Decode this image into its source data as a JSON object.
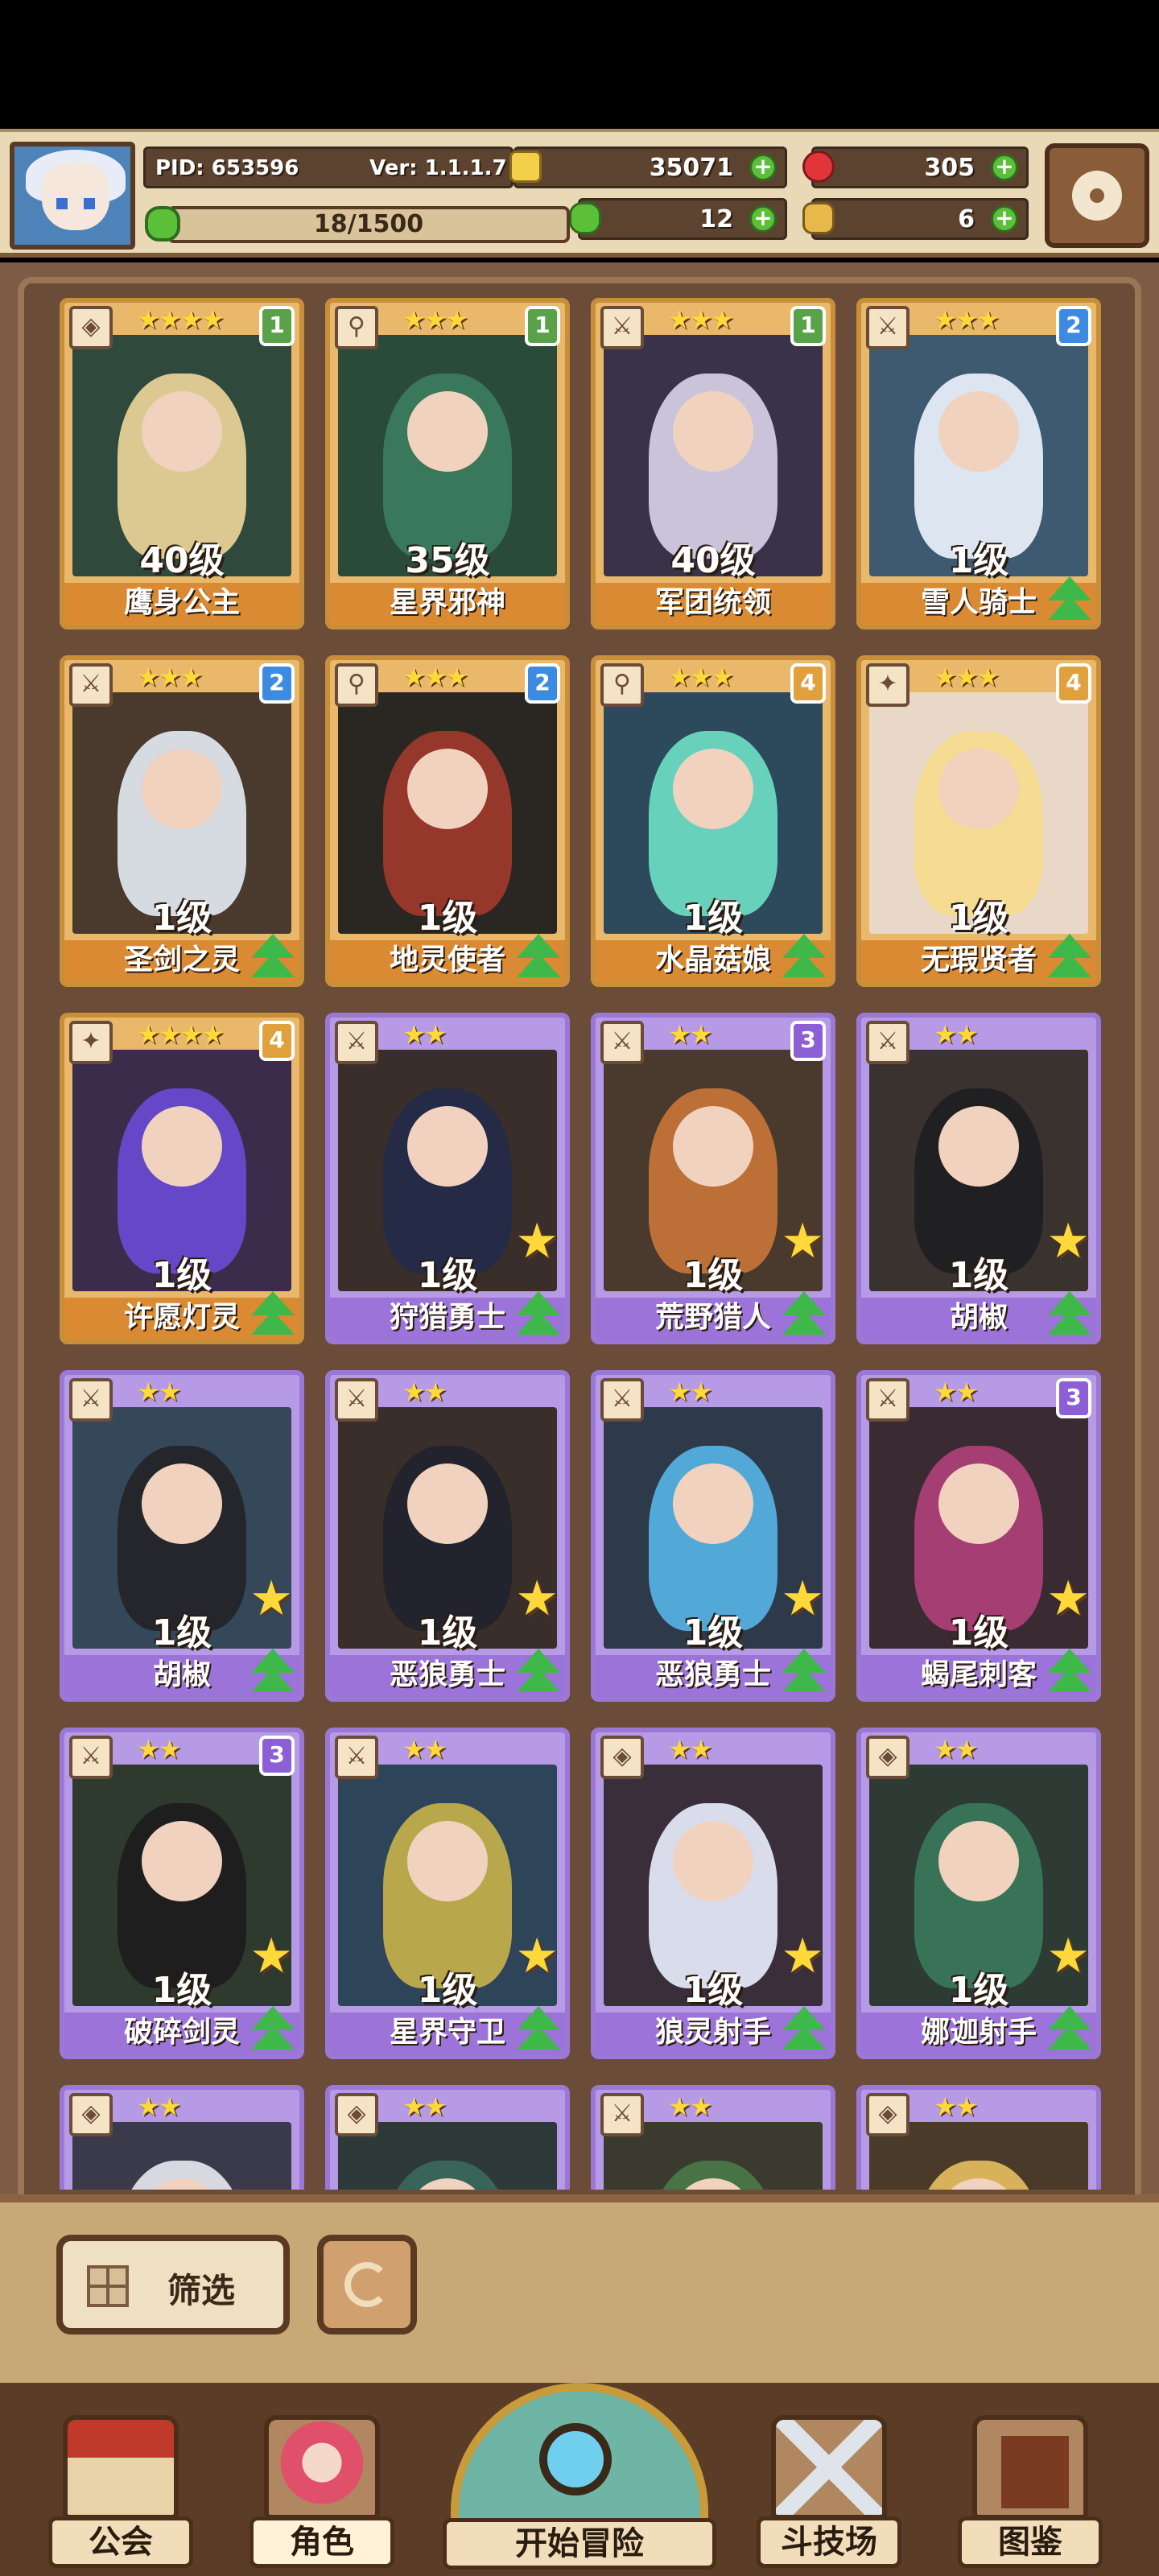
{
  "header": {
    "pid": "PID: 653596",
    "version": "Ver: 1.1.1.7",
    "gold": "35071",
    "gems": "305",
    "energy": "18/1500",
    "clover": "12",
    "item": "6",
    "energy_progress": 0.012
  },
  "cards": [
    {
      "name": "鹰身公主",
      "level": "40级",
      "stars": "★★★★",
      "badge": "1",
      "badge_color": "green",
      "frame": "gold",
      "art_color": "#2f4a3c",
      "hair_color": "#f0d79a",
      "upgrade": false,
      "class_icon": "shield-icon"
    },
    {
      "name": "星界邪神",
      "level": "35级",
      "stars": "★★★",
      "badge": "1",
      "badge_color": "green",
      "frame": "gold",
      "art_color": "#2a4a3a",
      "hair_color": "#3b7d5f",
      "upgrade": false,
      "class_icon": "staff-icon"
    },
    {
      "name": "军团统领",
      "level": "40级",
      "stars": "★★★",
      "badge": "1",
      "badge_color": "green",
      "frame": "gold",
      "art_color": "#3a3248",
      "hair_color": "#dcd3ea",
      "upgrade": false,
      "class_icon": "sword-icon"
    },
    {
      "name": "雪人骑士",
      "level": "1级",
      "stars": "★★★",
      "badge": "2",
      "badge_color": "blue",
      "frame": "gold",
      "art_color": "#3e5a70",
      "hair_color": "#eef4ff",
      "upgrade": true,
      "class_icon": "sword-icon"
    },
    {
      "name": "圣剑之灵",
      "level": "1级",
      "stars": "★★★",
      "badge": "2",
      "badge_color": "blue",
      "frame": "gold",
      "art_color": "#4a3a2e",
      "hair_color": "#e6ecf5",
      "upgrade": true,
      "class_icon": "sword-icon"
    },
    {
      "name": "地灵使者",
      "level": "1级",
      "stars": "★★★",
      "badge": "2",
      "badge_color": "blue",
      "frame": "gold",
      "art_color": "#2a2622",
      "hair_color": "#a23a2e",
      "upgrade": true,
      "class_icon": "staff-icon"
    },
    {
      "name": "水晶菇娘",
      "level": "1级",
      "stars": "★★★",
      "badge": "4",
      "badge_color": "gold",
      "frame": "gold",
      "art_color": "#2c4a5c",
      "hair_color": "#6fe0c5",
      "upgrade": true,
      "class_icon": "staff-icon"
    },
    {
      "name": "无瑕贤者",
      "level": "1级",
      "stars": "★★★",
      "badge": "4",
      "badge_color": "gold",
      "frame": "gold",
      "art_color": "#e9d8c8",
      "hair_color": "#f7dc8c",
      "upgrade": true,
      "class_icon": "star-icon"
    },
    {
      "name": "许愿灯灵",
      "level": "1级",
      "stars": "★★★★",
      "badge": "4",
      "badge_color": "gold",
      "frame": "gold",
      "art_color": "#3a2c4a",
      "hair_color": "#6b4ad6",
      "upgrade": true,
      "class_icon": "star-icon"
    },
    {
      "name": "狩猎勇士",
      "level": "1级",
      "stars": "★★",
      "badge": "",
      "badge_color": "",
      "frame": "purple",
      "art_color": "#3a2e2a",
      "hair_color": "#232a4a",
      "upgrade": true,
      "class_icon": "sword-icon",
      "big_star": true
    },
    {
      "name": "荒野猎人",
      "level": "1级",
      "stars": "★★",
      "badge": "3",
      "badge_color": "purple",
      "frame": "purple",
      "art_color": "#4a3a2e",
      "hair_color": "#c9773a",
      "upgrade": true,
      "class_icon": "sword-icon",
      "big_star": true
    },
    {
      "name": "胡椒",
      "level": "1级",
      "stars": "★★",
      "badge": "",
      "badge_color": "",
      "frame": "purple",
      "art_color": "#3a322e",
      "hair_color": "#1e1e22",
      "upgrade": true,
      "class_icon": "sword-icon",
      "big_star": true
    },
    {
      "name": "胡椒",
      "level": "1级",
      "stars": "★★",
      "badge": "",
      "badge_color": "",
      "frame": "purple",
      "art_color": "#34485a",
      "hair_color": "#222226",
      "upgrade": true,
      "class_icon": "sword-icon",
      "big_star": true
    },
    {
      "name": "恶狼勇士",
      "level": "1级",
      "stars": "★★",
      "badge": "",
      "badge_color": "",
      "frame": "purple",
      "art_color": "#3a2e2a",
      "hair_color": "#20222c",
      "upgrade": true,
      "class_icon": "sword-icon",
      "big_star": true
    },
    {
      "name": "恶狼勇士",
      "level": "1级",
      "stars": "★★",
      "badge": "",
      "badge_color": "",
      "frame": "purple",
      "art_color": "#2e3a4a",
      "hair_color": "#57b6e8",
      "upgrade": true,
      "class_icon": "sword-icon",
      "big_star": true
    },
    {
      "name": "蝎尾刺客",
      "level": "1级",
      "stars": "★★",
      "badge": "3",
      "badge_color": "purple",
      "frame": "purple",
      "art_color": "#3a2a32",
      "hair_color": "#b0407a",
      "upgrade": true,
      "class_icon": "sword-icon",
      "big_star": true
    },
    {
      "name": "破碎剑灵",
      "level": "1级",
      "stars": "★★",
      "badge": "3",
      "badge_color": "purple",
      "frame": "purple",
      "art_color": "#2e3a2e",
      "hair_color": "#1c1c1c",
      "upgrade": true,
      "class_icon": "sword-icon",
      "big_star": true
    },
    {
      "name": "星界守卫",
      "level": "1级",
      "stars": "★★",
      "badge": "",
      "badge_color": "",
      "frame": "purple",
      "art_color": "#2e4458",
      "hair_color": "#c8b44a",
      "upgrade": true,
      "class_icon": "sword-icon",
      "big_star": true
    },
    {
      "name": "狼灵射手",
      "level": "1级",
      "stars": "★★",
      "badge": "",
      "badge_color": "",
      "frame": "purple",
      "art_color": "#3a2e3a",
      "hair_color": "#eaf0ff",
      "upgrade": true,
      "class_icon": "shield-icon",
      "big_star": true
    },
    {
      "name": "娜迦射手",
      "level": "1级",
      "stars": "★★",
      "badge": "",
      "badge_color": "",
      "frame": "purple",
      "art_color": "#2e3a34",
      "hair_color": "#3a7a5c",
      "upgrade": true,
      "class_icon": "shield-icon",
      "big_star": true
    },
    {
      "name": "",
      "level": "",
      "stars": "★★",
      "badge": "",
      "badge_color": "",
      "frame": "purple",
      "art_color": "#3a3a4a",
      "hair_color": "#eaeaf2",
      "upgrade": false,
      "class_icon": "shield-icon"
    },
    {
      "name": "",
      "level": "",
      "stars": "★★",
      "badge": "",
      "badge_color": "",
      "frame": "purple",
      "art_color": "#2e3a3a",
      "hair_color": "#3a6a5c",
      "upgrade": false,
      "class_icon": "shield-icon"
    },
    {
      "name": "",
      "level": "",
      "stars": "★★",
      "badge": "",
      "badge_color": "",
      "frame": "purple",
      "art_color": "#3a3a2e",
      "hair_color": "#4a7a4a",
      "upgrade": false,
      "class_icon": "sword-icon"
    },
    {
      "name": "",
      "level": "",
      "stars": "★★",
      "badge": "",
      "badge_color": "",
      "frame": "purple",
      "art_color": "#4a3a2a",
      "hair_color": "#e8c060",
      "upgrade": false,
      "class_icon": "shield-icon"
    }
  ],
  "controls": {
    "filter_label": "筛选"
  },
  "nav": {
    "guild": "公会",
    "characters": "角色",
    "adventure": "开始冒险",
    "arena": "斗技场",
    "codex": "图鉴"
  }
}
